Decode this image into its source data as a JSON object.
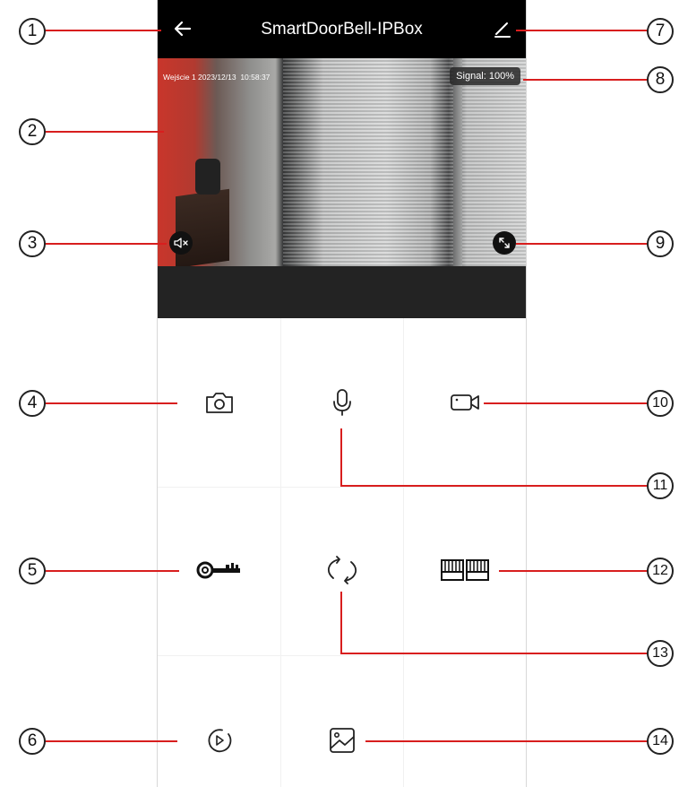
{
  "header": {
    "title": "SmartDoorBell-IPBox",
    "back_icon": "arrow-left-icon",
    "edit_icon": "pencil-icon"
  },
  "video": {
    "osd_text": "Wejście 1 2023/12/13  10:58:37",
    "signal_label": "Signal: 100%",
    "mute_icon": "speaker-muted-icon",
    "fullscreen_icon": "fullscreen-icon"
  },
  "controls": [
    {
      "name": "snapshot",
      "icon": "camera-icon"
    },
    {
      "name": "microphone",
      "icon": "microphone-icon"
    },
    {
      "name": "record",
      "icon": "video-camera-icon"
    },
    {
      "name": "unlock",
      "icon": "key-icon"
    },
    {
      "name": "switch",
      "icon": "refresh-icon"
    },
    {
      "name": "gate",
      "icon": "gate-icon"
    },
    {
      "name": "playback",
      "icon": "play-circle-icon"
    },
    {
      "name": "gallery",
      "icon": "image-icon"
    }
  ],
  "annotations": [
    "1",
    "2",
    "3",
    "4",
    "5",
    "6",
    "7",
    "8",
    "9",
    "10",
    "11",
    "12",
    "13",
    "14"
  ],
  "colors": {
    "callout_line": "#d81e1e",
    "topbar": "#000000",
    "band": "#232323"
  }
}
